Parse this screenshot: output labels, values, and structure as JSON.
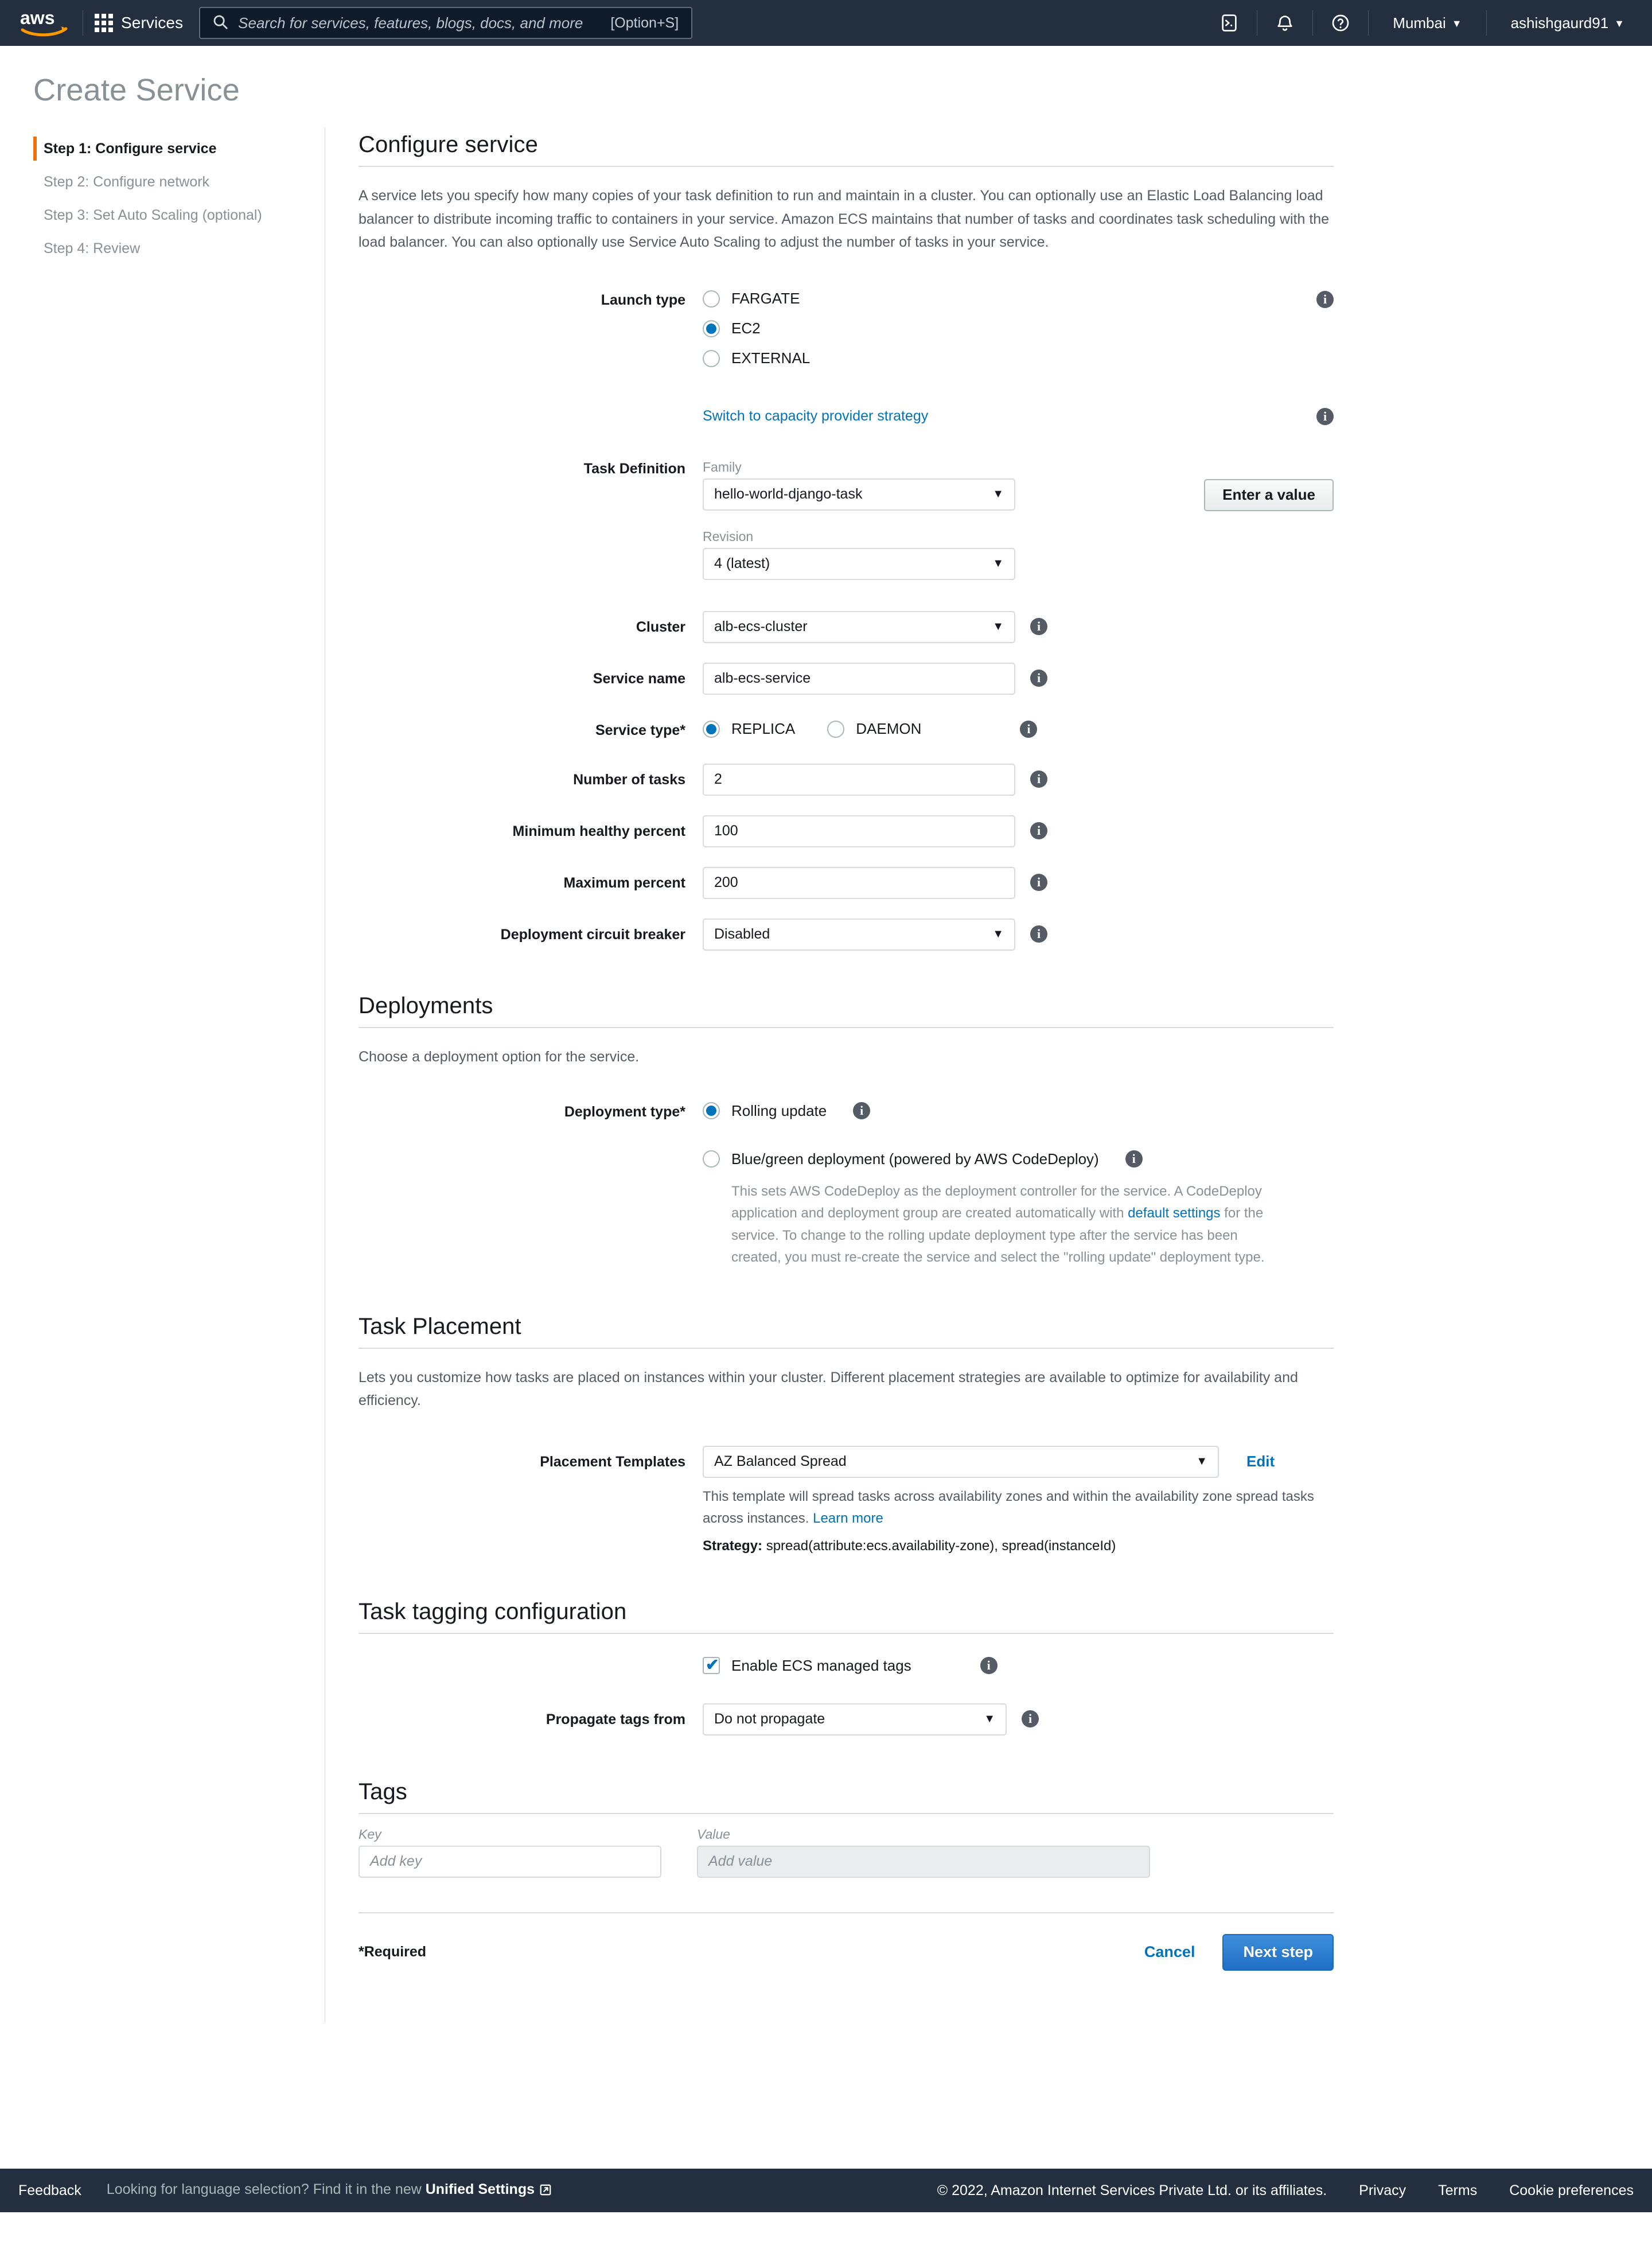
{
  "topnav": {
    "logo_alt": "aws",
    "services_label": "Services",
    "search": {
      "placeholder": "Search for services, features, blogs, docs, and more",
      "value": "",
      "shortcut": "[Option+S]"
    },
    "cloudshell_icon": "cloudshell-icon",
    "bell_icon": "notifications-icon",
    "help_icon": "help-icon",
    "region": "Mumbai",
    "account": "ashishgaurd91",
    "caret": "▼"
  },
  "page": {
    "title": "Create Service"
  },
  "sidebar": {
    "steps": [
      {
        "label": "Step 1: Configure service",
        "active": true
      },
      {
        "label": "Step 2: Configure network",
        "active": false
      },
      {
        "label": "Step 3: Set Auto Scaling (optional)",
        "active": false
      },
      {
        "label": "Step 4: Review",
        "active": false
      }
    ]
  },
  "configure_service": {
    "heading": "Configure service",
    "description": "A service lets you specify how many copies of your task definition to run and maintain in a cluster. You can optionally use an Elastic Load Balancing load balancer to distribute incoming traffic to containers in your service. Amazon ECS maintains that number of tasks and coordinates task scheduling with the load balancer. You can also optionally use Service Auto Scaling to adjust the number of tasks in your service.",
    "launch_type": {
      "label": "Launch type",
      "options": [
        "FARGATE",
        "EC2",
        "EXTERNAL"
      ],
      "selected": "EC2",
      "switch_link": "Switch to capacity provider strategy"
    },
    "task_definition": {
      "label": "Task Definition",
      "family_label": "Family",
      "family_value": "hello-world-django-task",
      "revision_label": "Revision",
      "revision_value": "4 (latest)",
      "enter_value_button": "Enter a value"
    },
    "cluster": {
      "label": "Cluster",
      "value": "alb-ecs-cluster"
    },
    "service_name": {
      "label": "Service name",
      "value": "alb-ecs-service"
    },
    "service_type": {
      "label": "Service type*",
      "options": [
        "REPLICA",
        "DAEMON"
      ],
      "selected": "REPLICA"
    },
    "number_of_tasks": {
      "label": "Number of tasks",
      "value": "2"
    },
    "minimum_healthy_percent": {
      "label": "Minimum healthy percent",
      "value": "100"
    },
    "maximum_percent": {
      "label": "Maximum percent",
      "value": "200"
    },
    "circuit_breaker": {
      "label": "Deployment circuit breaker",
      "value": "Disabled"
    }
  },
  "deployments": {
    "heading": "Deployments",
    "description": "Choose a deployment option for the service.",
    "type_label": "Deployment type*",
    "option_rolling": "Rolling update",
    "option_bluegreen": "Blue/green deployment (powered by AWS CodeDeploy)",
    "selected": "Rolling update",
    "bluegreen_help_1": "This sets AWS CodeDeploy as the deployment controller for the service. A CodeDeploy application and deployment group are created automatically with ",
    "bluegreen_help_link": "default settings",
    "bluegreen_help_2": " for the service. To change to the rolling update deployment type after the service has been created, you must re-create the service and select the \"rolling update\" deployment type."
  },
  "task_placement": {
    "heading": "Task Placement",
    "description": "Lets you customize how tasks are placed on instances within your cluster. Different placement strategies are available to optimize for availability and efficiency.",
    "templates_label": "Placement Templates",
    "templates_value": "AZ Balanced Spread",
    "edit_link": "Edit",
    "help_text": "This template will spread tasks across availability zones and within the availability zone spread tasks across instances. ",
    "help_link": "Learn more",
    "strategy_label": "Strategy:",
    "strategy_value": " spread(attribute:ecs.availability-zone), spread(instanceId)"
  },
  "task_tagging": {
    "heading": "Task tagging configuration",
    "managed_tags_label": "Enable ECS managed tags",
    "managed_tags_checked": true,
    "propagate_label": "Propagate tags from",
    "propagate_value": "Do not propagate"
  },
  "tags": {
    "heading": "Tags",
    "key_header": "Key",
    "value_header": "Value",
    "key_placeholder": "Add key",
    "value_placeholder": "Add value"
  },
  "form_footer": {
    "required_note": "*Required",
    "cancel": "Cancel",
    "next": "Next step"
  },
  "bottombar": {
    "feedback": "Feedback",
    "language_note": "Looking for language selection? Find it in the new ",
    "unified_settings": "Unified Settings",
    "copyright": "© 2022, Amazon Internet Services Private Ltd. or its affiliates.",
    "privacy": "Privacy",
    "terms": "Terms",
    "cookie_preferences": "Cookie preferences"
  },
  "colors": {
    "nav_bg": "#232f3e",
    "accent_orange": "#ec7211",
    "link_blue": "#0073bb",
    "radio_blue": "#0073bb",
    "primary_button": "#1f6fc4"
  }
}
